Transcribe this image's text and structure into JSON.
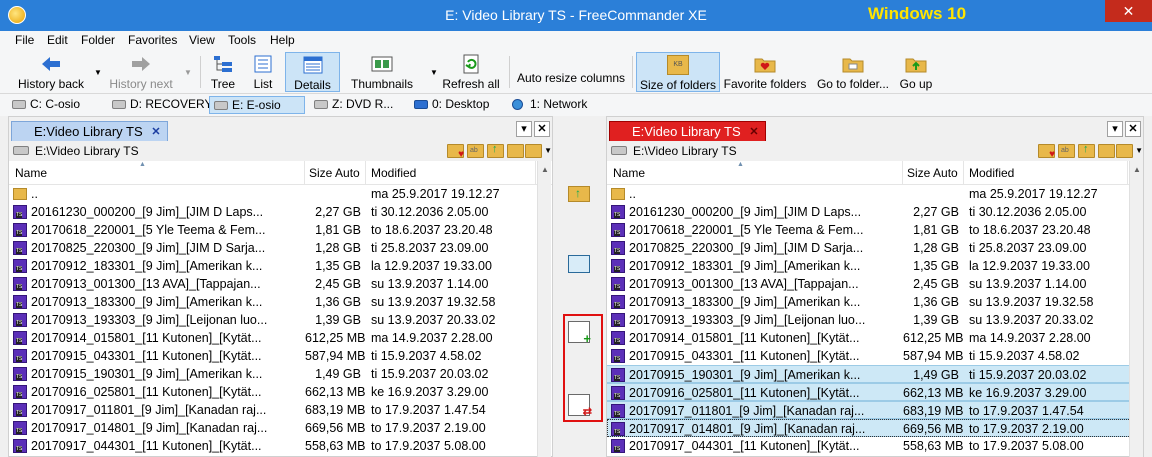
{
  "window": {
    "title": "E: Video Library TS - FreeCommander XE",
    "badge": "Windows 10",
    "close": "✕"
  },
  "menu": [
    "File",
    "Edit",
    "Folder",
    "Favorites",
    "View",
    "Tools",
    "Help"
  ],
  "toolbar": {
    "history_back": "History back",
    "history_next": "History next",
    "tree": "Tree",
    "list": "List",
    "details": "Details",
    "thumbnails": "Thumbnails",
    "refresh_all": "Refresh all",
    "auto_resize": "Auto resize columns",
    "size_of_folders": "Size of folders",
    "favorite_folders": "Favorite folders",
    "go_to_folder": "Go to folder...",
    "go_up": "Go up",
    "size_icon_label": "KB"
  },
  "drives": [
    {
      "label": "C: C-osio"
    },
    {
      "label": "D: RECOVERY"
    },
    {
      "label": "E: E-osio"
    },
    {
      "label": "Z: DVD R..."
    },
    {
      "label": "0: Desktop"
    },
    {
      "label": "1: Network"
    }
  ],
  "columns": {
    "name": "Name",
    "size": "Size Auto",
    "modified": "Modified"
  },
  "left_panel": {
    "tab": "E:Video Library TS",
    "tab_close": "✕",
    "path": "E:\\Video Library TS",
    "rows": [
      {
        "name": "..",
        "size": "",
        "modified": "ma 25.9.2017 19.12.27"
      },
      {
        "name": "20161230_000200_[9 Jim]_[JIM D  Laps...",
        "size": "2,27 GB",
        "modified": "ti 30.12.2036 2.05.00"
      },
      {
        "name": "20170618_220001_[5 Yle Teema & Fem...",
        "size": "1,81 GB",
        "modified": "to 18.6.2037 23.20.48"
      },
      {
        "name": "20170825_220300_[9 Jim]_[JIM D  Sarja...",
        "size": "1,28 GB",
        "modified": "ti 25.8.2037 23.09.00"
      },
      {
        "name": "20170912_183301_[9 Jim]_[Amerikan k...",
        "size": "1,35 GB",
        "modified": "la 12.9.2037 19.33.00"
      },
      {
        "name": "20170913_001300_[13 AVA]_[Tappajan...",
        "size": "2,45 GB",
        "modified": "su 13.9.2037 1.14.00"
      },
      {
        "name": "20170913_183300_[9 Jim]_[Amerikan k...",
        "size": "1,36 GB",
        "modified": "su 13.9.2037 19.32.58"
      },
      {
        "name": "20170913_193303_[9 Jim]_[Leijonan luo...",
        "size": "1,39 GB",
        "modified": "su 13.9.2037 20.33.02"
      },
      {
        "name": "20170914_015801_[11 Kutonen]_[Kytät...",
        "size": "612,25 MB",
        "modified": "ma 14.9.2037 2.28.00"
      },
      {
        "name": "20170915_043301_[11 Kutonen]_[Kytät...",
        "size": "587,94 MB",
        "modified": "ti 15.9.2037 4.58.02"
      },
      {
        "name": "20170915_190301_[9 Jim]_[Amerikan k...",
        "size": "1,49 GB",
        "modified": "ti 15.9.2037 20.03.02"
      },
      {
        "name": "20170916_025801_[11 Kutonen]_[Kytät...",
        "size": "662,13 MB",
        "modified": "ke 16.9.2037 3.29.00"
      },
      {
        "name": "20170917_011801_[9 Jim]_[Kanadan raj...",
        "size": "683,19 MB",
        "modified": "to 17.9.2037 1.47.54"
      },
      {
        "name": "20170917_014801_[9 Jim]_[Kanadan raj...",
        "size": "669,56 MB",
        "modified": "to 17.9.2037 2.19.00"
      },
      {
        "name": "20170917_044301_[11 Kutonen]_[Kytät...",
        "size": "558,63 MB",
        "modified": "to 17.9.2037 5.08.00"
      }
    ]
  },
  "right_panel": {
    "tab": "E:Video Library TS",
    "tab_close": "✕",
    "path": "E:\\Video Library TS",
    "rows": [
      {
        "name": "..",
        "size": "",
        "modified": "ma 25.9.2017 19.12.27"
      },
      {
        "name": "20161230_000200_[9 Jim]_[JIM D  Laps...",
        "size": "2,27 GB",
        "modified": "ti 30.12.2036 2.05.00"
      },
      {
        "name": "20170618_220001_[5 Yle Teema & Fem...",
        "size": "1,81 GB",
        "modified": "to 18.6.2037 23.20.48"
      },
      {
        "name": "20170825_220300_[9 Jim]_[JIM D  Sarja...",
        "size": "1,28 GB",
        "modified": "ti 25.8.2037 23.09.00"
      },
      {
        "name": "20170912_183301_[9 Jim]_[Amerikan k...",
        "size": "1,35 GB",
        "modified": "la 12.9.2037 19.33.00"
      },
      {
        "name": "20170913_001300_[13 AVA]_[Tappajan...",
        "size": "2,45 GB",
        "modified": "su 13.9.2037 1.14.00"
      },
      {
        "name": "20170913_183300_[9 Jim]_[Amerikan k...",
        "size": "1,36 GB",
        "modified": "su 13.9.2037 19.32.58"
      },
      {
        "name": "20170913_193303_[9 Jim]_[Leijonan luo...",
        "size": "1,39 GB",
        "modified": "su 13.9.2037 20.33.02"
      },
      {
        "name": "20170914_015801_[11 Kutonen]_[Kytät...",
        "size": "612,25 MB",
        "modified": "ma 14.9.2037 2.28.00"
      },
      {
        "name": "20170915_043301_[11 Kutonen]_[Kytät...",
        "size": "587,94 MB",
        "modified": "ti 15.9.2037 4.58.02"
      },
      {
        "name": "20170915_190301_[9 Jim]_[Amerikan k...",
        "size": "1,49 GB",
        "modified": "ti 15.9.2037 20.03.02",
        "selected": true
      },
      {
        "name": "20170916_025801_[11 Kutonen]_[Kytät...",
        "size": "662,13 MB",
        "modified": "ke 16.9.2037 3.29.00",
        "selected": true
      },
      {
        "name": "20170917_011801_[9 Jim]_[Kanadan raj...",
        "size": "683,19 MB",
        "modified": "to 17.9.2037 1.47.54",
        "selected": true
      },
      {
        "name": "20170917_014801_[9 Jim]_[Kanadan raj...",
        "size": "669,56 MB",
        "modified": "to 17.9.2037 2.19.00",
        "selected": true,
        "focused": true
      },
      {
        "name": "20170917_044301_[11 Kutonen]_[Kytät...",
        "size": "558,63 MB",
        "modified": "to 17.9.2037 5.08.00"
      }
    ]
  },
  "colors": {
    "title_blue": "#2b7fd8",
    "active_tab_red": "#e02020",
    "selection": "#cde8f6",
    "highlight_box": "#e01010"
  }
}
